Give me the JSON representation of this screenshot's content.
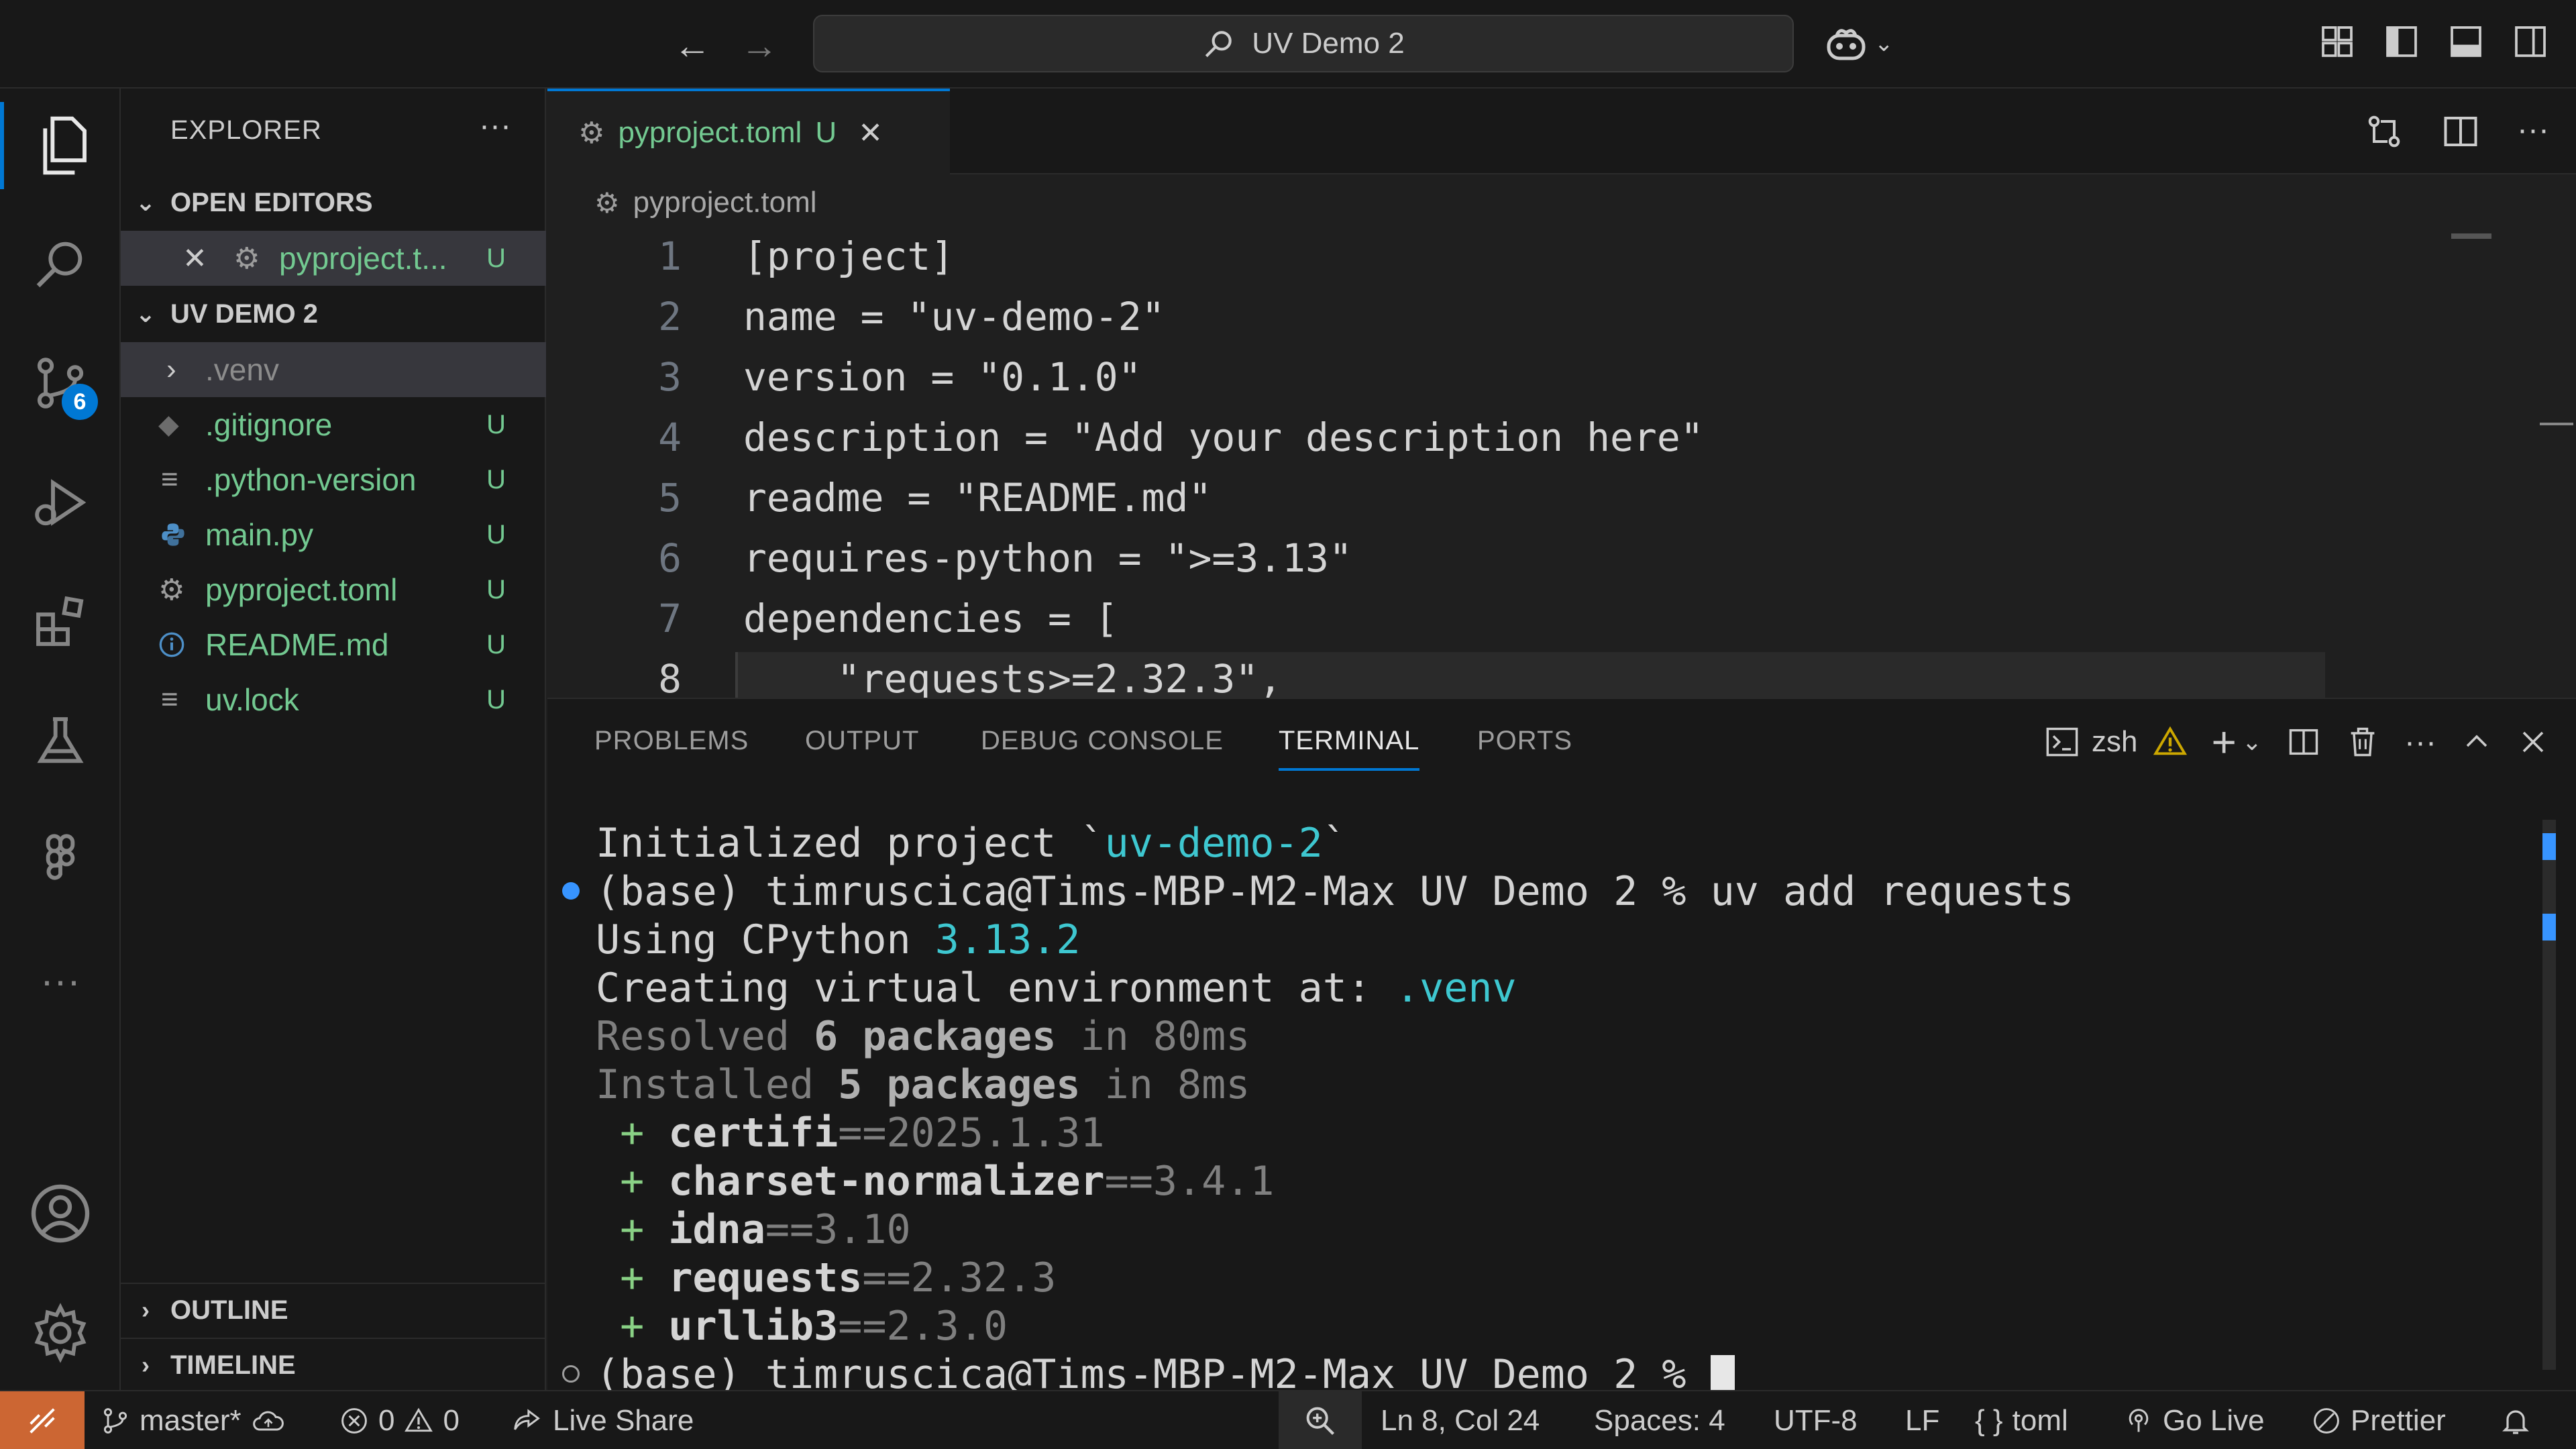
{
  "titlebar": {
    "search_label": "UV Demo 2"
  },
  "activity_bar": {
    "source_control_badge": "6",
    "items": [
      "explorer-icon",
      "search-icon",
      "source-control-icon",
      "run-debug-icon",
      "extensions-icon",
      "testing-icon",
      "figma-icon",
      "more-icon",
      "accounts-icon",
      "manage-gear-icon"
    ]
  },
  "sidebar": {
    "title": "EXPLORER",
    "open_editors": {
      "header": "OPEN EDITORS",
      "items": [
        {
          "name": "pyproject.t...",
          "status": "U"
        }
      ]
    },
    "workspace": {
      "header": "UV DEMO 2",
      "items": [
        {
          "name": ".venv",
          "status": "",
          "icon": "chevron-right-icon"
        },
        {
          "name": ".gitignore",
          "status": "U",
          "icon": "git-icon"
        },
        {
          "name": ".python-version",
          "status": "U",
          "icon": "lines-icon"
        },
        {
          "name": "main.py",
          "status": "U",
          "icon": "python-icon"
        },
        {
          "name": "pyproject.toml",
          "status": "U",
          "icon": "gear-icon"
        },
        {
          "name": "README.md",
          "status": "U",
          "icon": "info-icon"
        },
        {
          "name": "uv.lock",
          "status": "U",
          "icon": "lines-icon"
        }
      ]
    },
    "outline_header": "OUTLINE",
    "timeline_header": "TIMELINE"
  },
  "editor": {
    "tab": {
      "name": "pyproject.toml",
      "status": "U"
    },
    "breadcrumb": "pyproject.toml",
    "lines": [
      {
        "n": "1",
        "text": "[project]"
      },
      {
        "n": "2",
        "text": "name = \"uv-demo-2\""
      },
      {
        "n": "3",
        "text": "version = \"0.1.0\""
      },
      {
        "n": "4",
        "text": "description = \"Add your description here\""
      },
      {
        "n": "5",
        "text": "readme = \"README.md\""
      },
      {
        "n": "6",
        "text": "requires-python = \">=3.13\""
      },
      {
        "n": "7",
        "text": "dependencies = ["
      },
      {
        "n": "8",
        "text": "    \"requests>=2.32.3\","
      }
    ]
  },
  "panel": {
    "tabs": [
      "PROBLEMS",
      "OUTPUT",
      "DEBUG CONSOLE",
      "TERMINAL",
      "PORTS"
    ],
    "active_tab": "TERMINAL",
    "shell": "zsh",
    "terminal": {
      "line1_a": "Initialized project `",
      "line1_b": "uv-demo-2",
      "line1_c": "`",
      "prompt": "(base) timruscica@Tims-MBP-M2-Max UV Demo 2 % ",
      "command": "uv add requests",
      "using_a": "Using CPython ",
      "using_b": "3.13.2",
      "creating_a": "Creating virtual environment at: ",
      "creating_b": ".venv",
      "resolved_a": "Resolved ",
      "resolved_b": "6 packages",
      "resolved_c": " in 80ms",
      "installed_a": "Installed ",
      "installed_b": "5 packages",
      "installed_c": " in 8ms",
      "packages": [
        {
          "name": "certifi",
          "version": "==2025.1.31"
        },
        {
          "name": "charset-normalizer",
          "version": "==3.4.1"
        },
        {
          "name": "idna",
          "version": "==3.10"
        },
        {
          "name": "requests",
          "version": "==2.32.3"
        },
        {
          "name": "urllib3",
          "version": "==2.3.0"
        }
      ],
      "final_prompt": "(base) timruscica@Tims-MBP-M2-Max UV Demo 2 % "
    }
  },
  "statusbar": {
    "branch": "master*",
    "errors": "0",
    "warnings": "0",
    "live_share": "Live Share",
    "position": "Ln 8, Col 24",
    "spaces": "Spaces: 4",
    "encoding": "UTF-8",
    "eol": "LF",
    "language": "toml",
    "go_live": "Go Live",
    "prettier": "Prettier"
  },
  "colors": {
    "accent": "#0078d4",
    "remote": "#cc6633",
    "untracked": "#73c991",
    "terminal_cyan": "#3ec7d0"
  }
}
